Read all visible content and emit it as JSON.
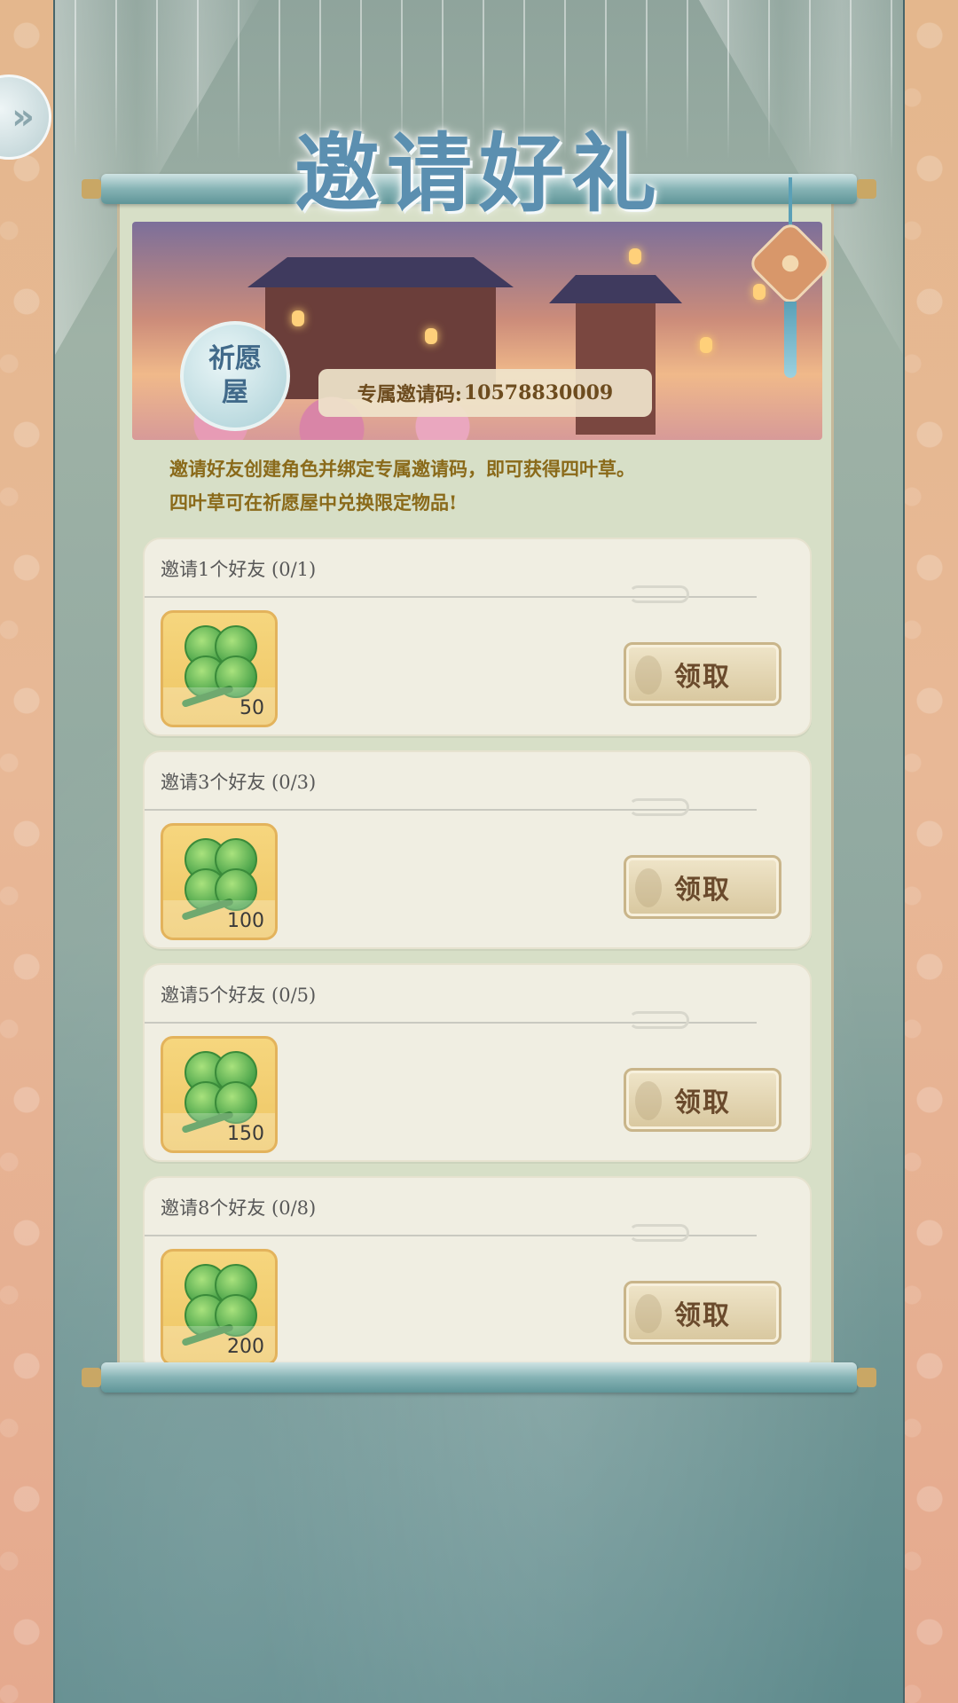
{
  "header": {
    "title": "邀请好礼",
    "back_icon": "double-chevron-right-icon"
  },
  "banner": {
    "wish_house_label": "祈愿屋",
    "invite_code_label": "专属邀请码:",
    "invite_code_value": "10578830009"
  },
  "description": {
    "line1": "邀请好友创建角色并绑定专属邀请码，即可获得四叶草。",
    "line2": "四叶草可在祈愿屋中兑换限定物品!"
  },
  "tasks": [
    {
      "title": "邀请1个好友 (0/1)",
      "reward_icon": "four-leaf-clover-icon",
      "reward_count": "50",
      "claim_label": "领取"
    },
    {
      "title": "邀请3个好友 (0/3)",
      "reward_icon": "four-leaf-clover-icon",
      "reward_count": "100",
      "claim_label": "领取"
    },
    {
      "title": "邀请5个好友 (0/5)",
      "reward_icon": "four-leaf-clover-icon",
      "reward_count": "150",
      "claim_label": "领取"
    },
    {
      "title": "邀请8个好友 (0/8)",
      "reward_icon": "four-leaf-clover-icon",
      "reward_count": "200",
      "claim_label": "领取"
    }
  ],
  "colors": {
    "title_blue": "#5b8fb0",
    "card_bg": "#f0eee2",
    "reward_gold": "#f6d67e",
    "claim_text": "#6a4a2c",
    "description_text": "#8a6a1a"
  }
}
